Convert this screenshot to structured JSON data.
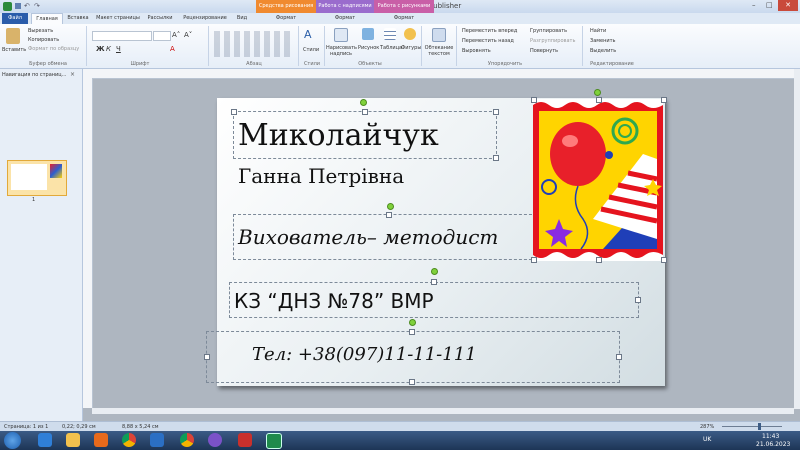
{
  "window": {
    "title": "Публикация1 - Microsoft Publisher",
    "context_tabs": [
      "Средства рисования",
      "Работа с надписями",
      "Работа с рисунками"
    ],
    "context_sub": [
      "Формат",
      "Формат",
      "Формат"
    ]
  },
  "tabs": [
    "Файл",
    "Главная",
    "Вставка",
    "Макет страницы",
    "Рассылки",
    "Рецензирование",
    "Вид"
  ],
  "ribbon": {
    "clipboard": {
      "paste": "Вставить",
      "cut": "Вырезать",
      "copy": "Копировать",
      "format": "Формат по образцу",
      "group": "Буфер обмена"
    },
    "font_group": "Шрифт",
    "paragraph_group": "Абзац",
    "styles": {
      "label": "Стили",
      "group": "Стили"
    },
    "objects": {
      "items": [
        "Нарисовать надпись",
        "Рисунок",
        "Таблица",
        "Фигуры"
      ],
      "group": "Объекты"
    },
    "wrap": {
      "label": "Обтекание текстом"
    },
    "arrange": {
      "items": [
        "Переместить вперед",
        "Переместить назад",
        "Выровнять",
        "Группировать",
        "Разгруппировать",
        "Повернуть"
      ],
      "group": "Упорядочить"
    },
    "editing": {
      "items": [
        "Найти",
        "Заменить",
        "Выделить"
      ],
      "group": "Редактирование"
    }
  },
  "nav": {
    "title": "Навигация по страниц...",
    "page_number": "1"
  },
  "card": {
    "surname": "Миколайчук",
    "name": "Ганна Петрівна",
    "position": "Вихователь– методист",
    "org": "КЗ “ДНЗ №78” ВМР",
    "phone": "Тел: +38(097)11-11-111"
  },
  "status": {
    "page": "Страница: 1 из 1",
    "position": "0,22; 0,29 см",
    "size": "8,88 x 5,24 см",
    "zoom": "287%"
  },
  "taskbar": {
    "lang": "UK",
    "time": "11:43",
    "date": "21.06.2023"
  },
  "colors": {
    "accent": "#2c5fa8",
    "tab_file": "#2a5caa",
    "ctx_drawing": "#f08a2f",
    "ctx_text": "#9a6ccd",
    "ctx_picture": "#c95fa7"
  }
}
